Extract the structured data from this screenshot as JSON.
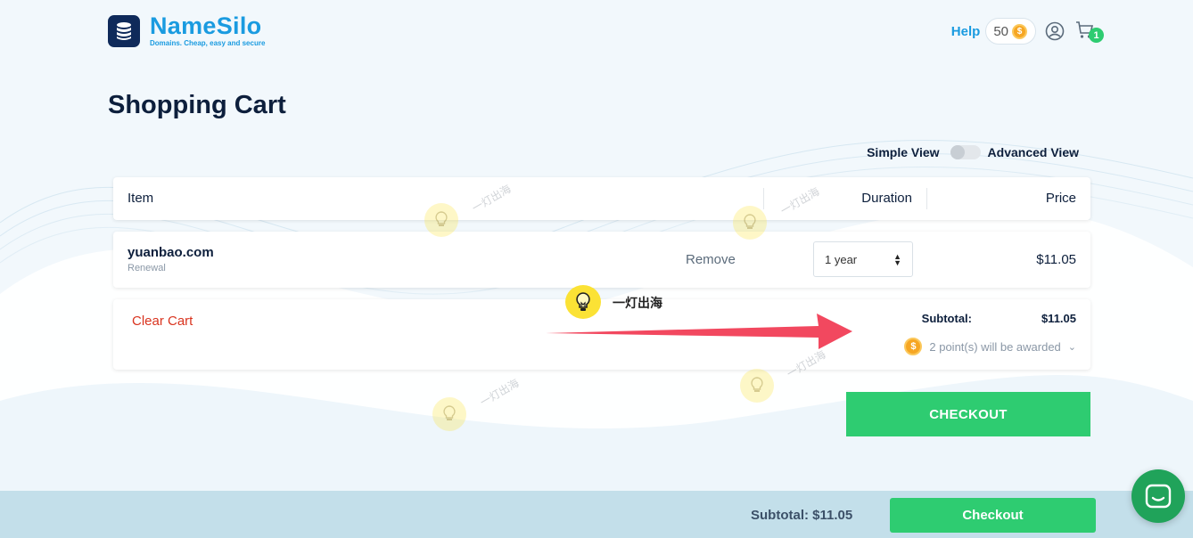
{
  "brand": {
    "name": "NameSilo",
    "tagline": "Domains. Cheap, easy and secure",
    "accent_color": "#1a9be0",
    "dark_color": "#0f2a5a"
  },
  "header": {
    "help_label": "Help",
    "points": "50",
    "cart_count": "1"
  },
  "page": {
    "title": "Shopping Cart"
  },
  "view_toggle": {
    "simple_label": "Simple View",
    "advanced_label": "Advanced View"
  },
  "table": {
    "headers": {
      "item": "Item",
      "duration": "Duration",
      "price": "Price"
    }
  },
  "cart_items": [
    {
      "domain": "yuanbao.com",
      "type": "Renewal",
      "remove_label": "Remove",
      "duration": "1 year",
      "price": "$11.05"
    }
  ],
  "summary": {
    "clear_cart_label": "Clear Cart",
    "subtotal_label": "Subtotal:",
    "subtotal_value": "$11.05",
    "points_award": "2 point(s) will be awarded"
  },
  "checkout_label": "CHECKOUT",
  "bottom_bar": {
    "subtotal_text": "Subtotal: $11.05",
    "checkout_label": "Checkout"
  },
  "overlay": {
    "annotation_text": "一灯出海",
    "watermark_text": "一灯出海",
    "arrow_color": "#f2485f"
  },
  "colors": {
    "green": "#2ecc71",
    "red_link": "#d9341f"
  }
}
